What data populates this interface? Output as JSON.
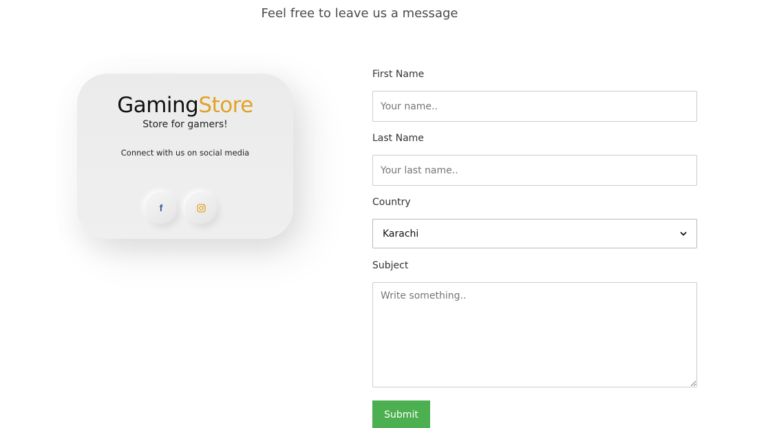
{
  "heading": "Feel free to leave us a message",
  "card": {
    "brand_part1": "Gaming",
    "brand_part2": "Store",
    "tagline": "Store for gamers!",
    "connect_text": "Connect with us on social media",
    "socials": [
      {
        "name": "facebook",
        "icon": "facebook-icon",
        "color": "#3b5998"
      },
      {
        "name": "instagram",
        "icon": "instagram-icon",
        "color": "#e0a327"
      }
    ]
  },
  "form": {
    "first_name_label": "First Name",
    "first_name_placeholder": "Your name..",
    "last_name_label": "Last Name",
    "last_name_placeholder": "Your last name..",
    "country_label": "Country",
    "country_selected": "Karachi",
    "subject_label": "Subject",
    "subject_placeholder": "Write something..",
    "submit_label": "Submit"
  },
  "colors": {
    "brand_accent": "#e0a327",
    "submit_bg": "#4caf50"
  }
}
